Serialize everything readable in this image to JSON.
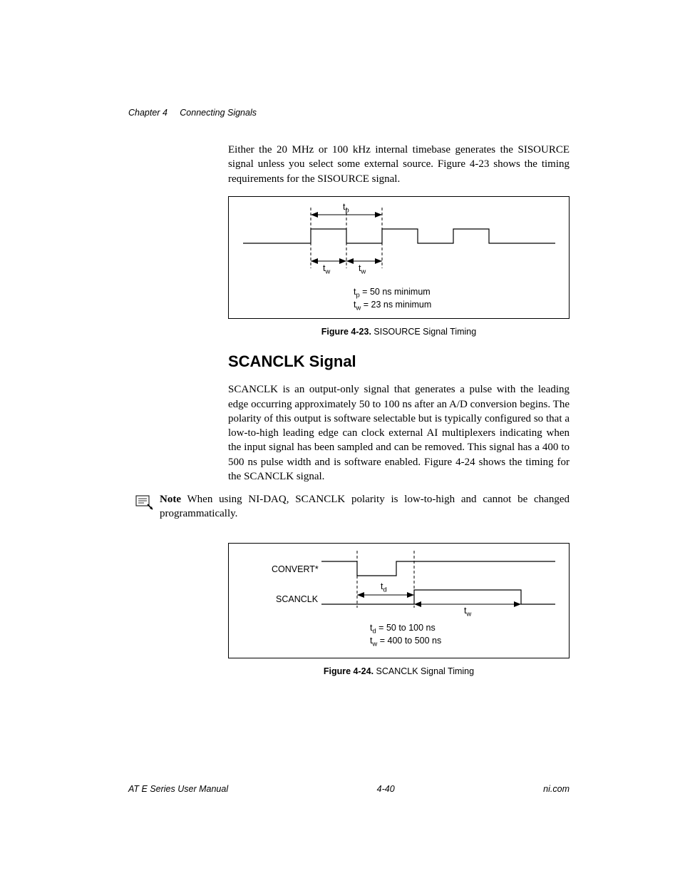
{
  "header": {
    "chapter": "Chapter 4",
    "title": "Connecting Signals"
  },
  "intro_para": "Either the 20 MHz or 100 kHz internal timebase generates the SISOURCE signal unless you select some external source. Figure 4-23 shows the timing requirements for the SISOURCE signal.",
  "fig1": {
    "tp_label": "t",
    "tp_sub": "p",
    "tw_label": "t",
    "tw_sub": "w",
    "spec1_a": "t",
    "spec1_b": "p",
    "spec1_c": " = 50 ns minimum",
    "spec2_a": "t",
    "spec2_b": "w",
    "spec2_c": " = 23 ns minimum",
    "caption_bold": "Figure 4-23.",
    "caption_rest": "  SISOURCE Signal Timing"
  },
  "section_heading": "SCANCLK Signal",
  "scanclk_para": "SCANCLK is an output-only signal that generates a pulse with the leading edge occurring approximately 50 to 100 ns after an A/D conversion begins. The polarity of this output is software selectable but is typically configured so that a low-to-high leading edge can clock external AI multiplexers indicating when the input signal has been sampled and can be removed. This signal has a 400 to 500 ns pulse width and is software enabled. Figure 4-24 shows the timing for the SCANCLK signal.",
  "note": {
    "label": "Note",
    "text": "   When using NI-DAQ, SCANCLK polarity is low-to-high and cannot be changed programmatically."
  },
  "fig2": {
    "convert_label": "CONVERT*",
    "scanclk_label": "SCANCLK",
    "td_label": "t",
    "td_sub": "d",
    "tw_label": "t",
    "tw_sub": "w",
    "spec1_a": "t",
    "spec1_b": "d",
    "spec1_c": " = 50 to 100 ns",
    "spec2_a": "t",
    "spec2_b": "w",
    "spec2_c": " = 400 to 500 ns",
    "caption_bold": "Figure 4-24.",
    "caption_rest": "  SCANCLK Signal Timing"
  },
  "footer": {
    "left": "AT E Series User Manual",
    "center": "4-40",
    "right": "ni.com"
  }
}
